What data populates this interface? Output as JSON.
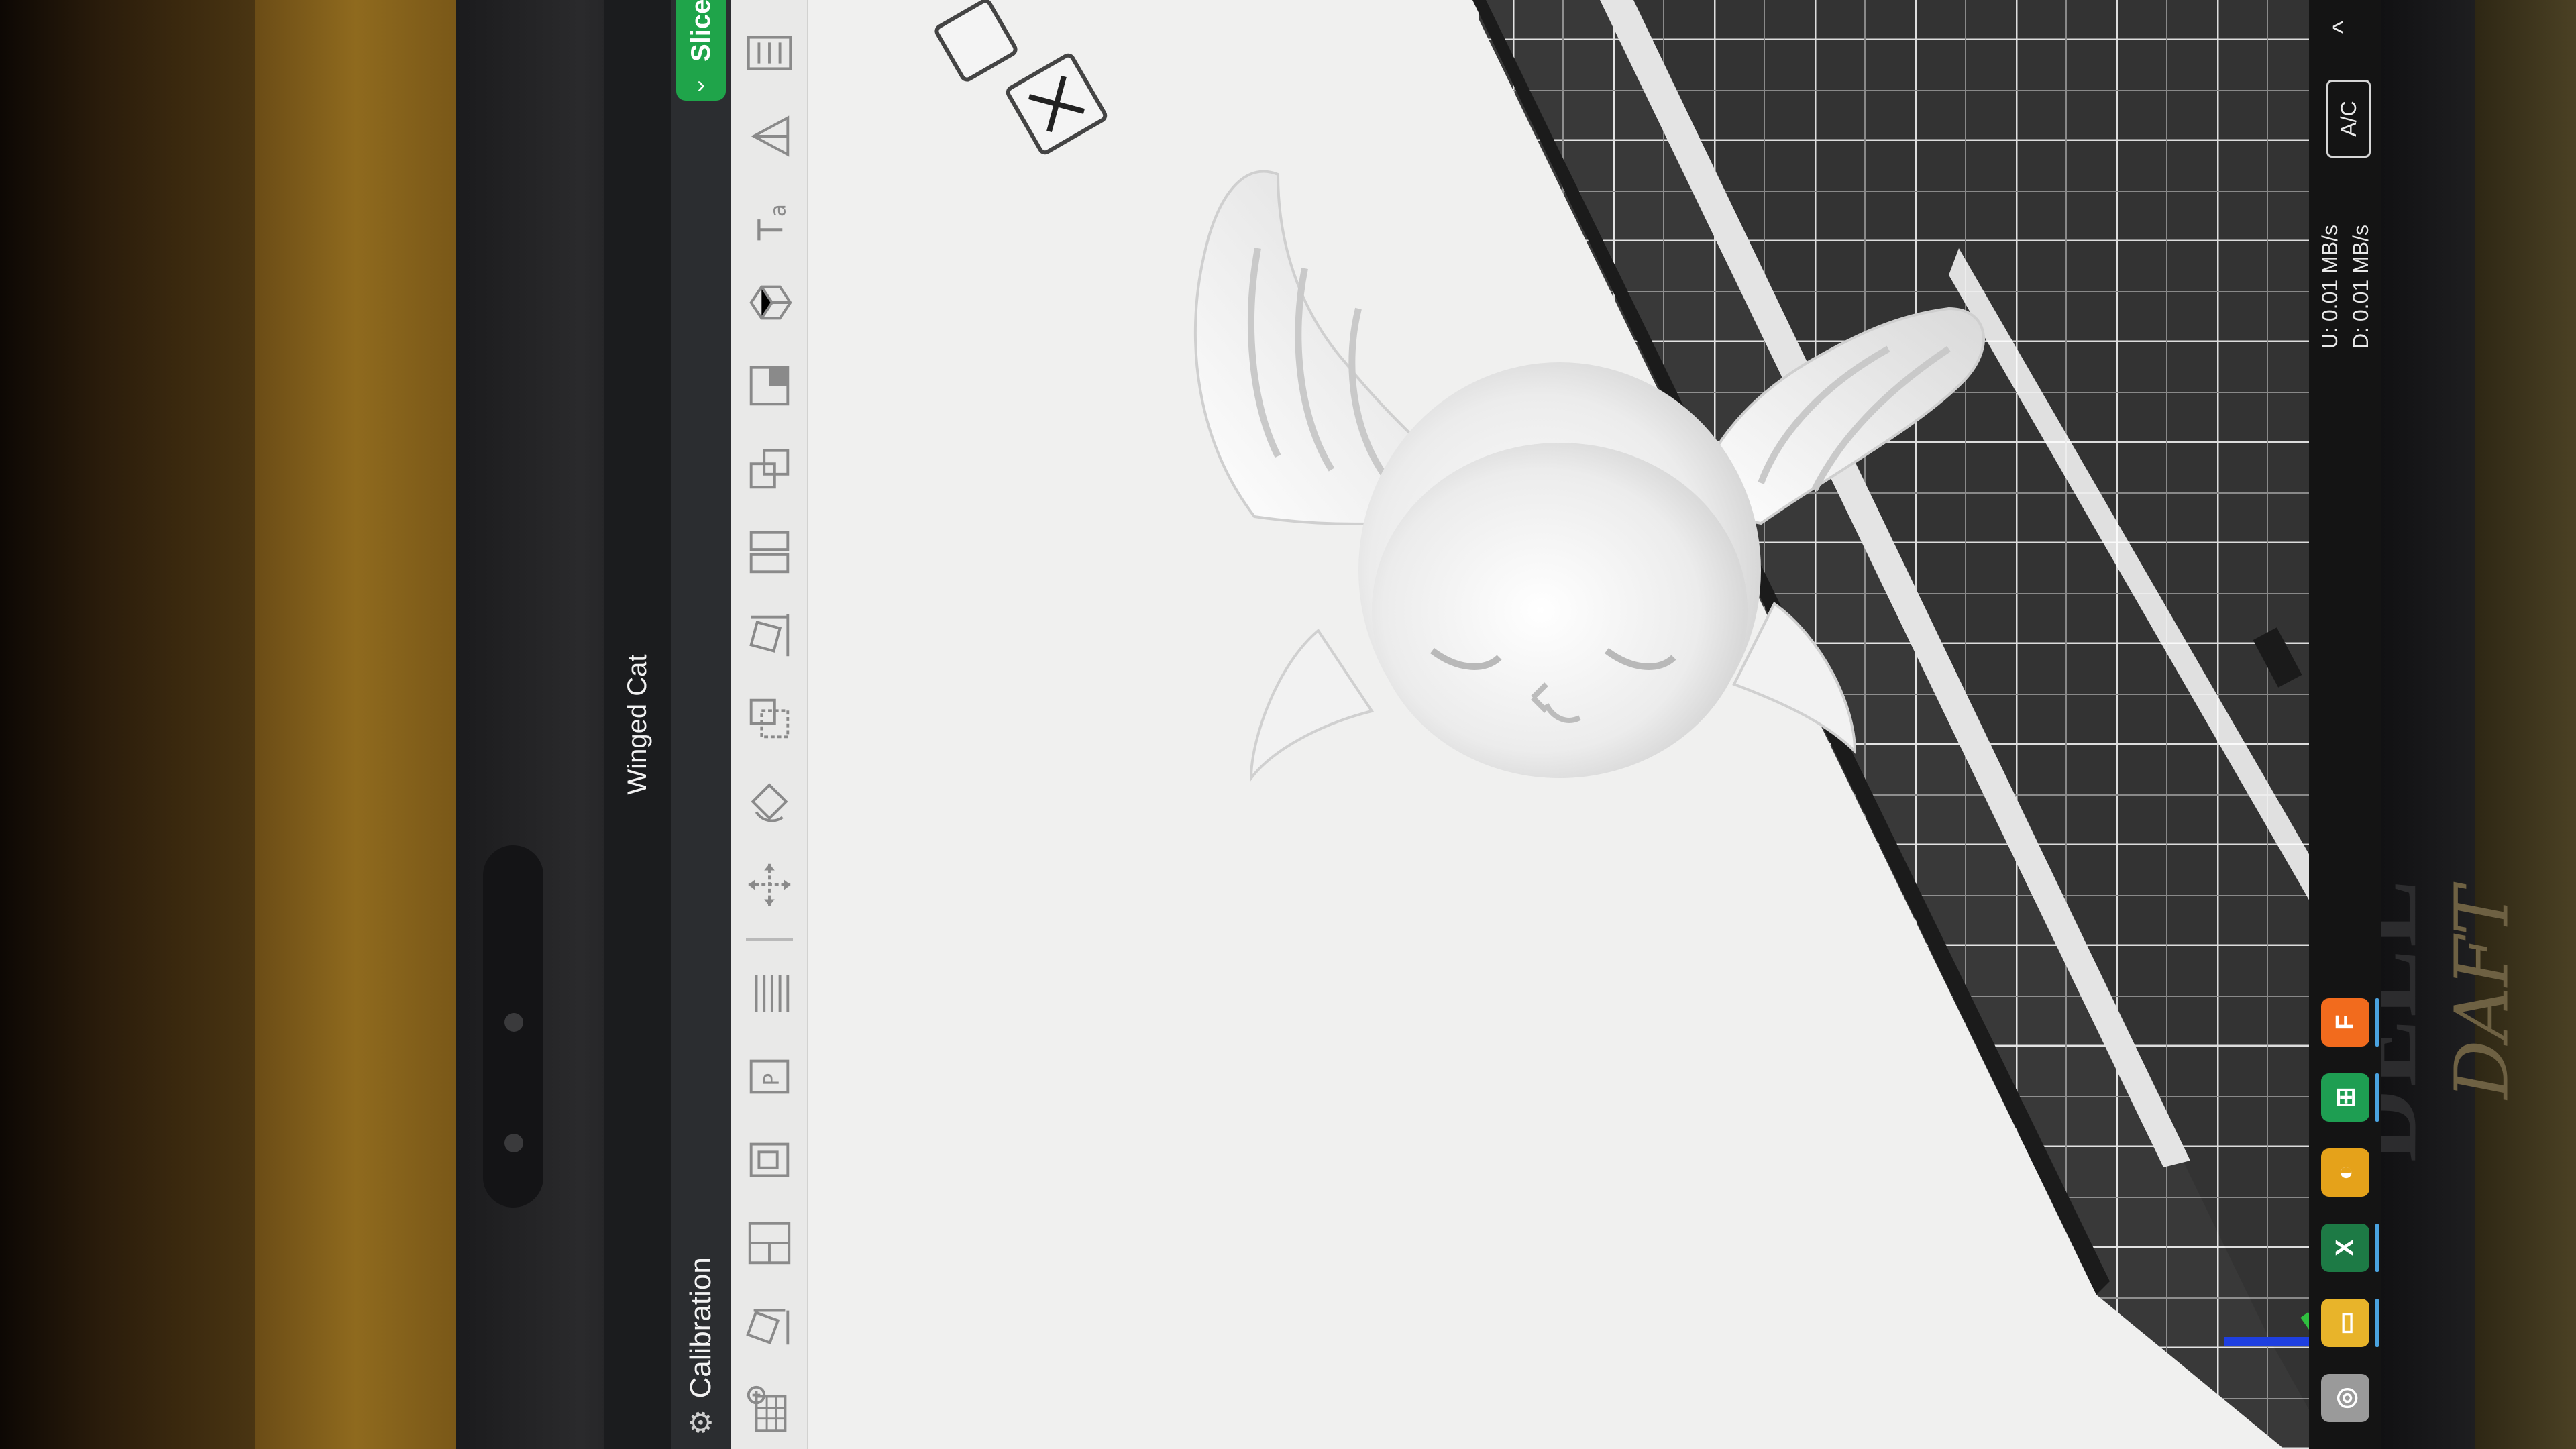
{
  "window": {
    "title": "Winged Cat"
  },
  "toolbar": {
    "calibration_label": "Calibration",
    "slice_label": "Slice"
  },
  "tools": [
    "add-plate",
    "auto-orient",
    "arrange",
    "plate-a",
    "plate-b",
    "layers",
    "move",
    "rotate",
    "scale",
    "place-on-face",
    "split",
    "cut",
    "support",
    "boolean",
    "text",
    "measure",
    "assembly"
  ],
  "taskbar": {
    "network_up": "U:  0.01 MB/s",
    "network_down": "D:  0.01 MB/s",
    "power_label": "A/C",
    "apps": [
      {
        "name": "chrome",
        "color": "#9a9a9a"
      },
      {
        "name": "file-explorer",
        "color": "#e8b42a"
      },
      {
        "name": "excel",
        "color": "#1d7a45",
        "glyph": "X"
      },
      {
        "name": "printer-app",
        "color": "#e5a21a"
      },
      {
        "name": "sheets",
        "color": "#1e9e52",
        "glyph": "⊞"
      },
      {
        "name": "orca-slicer",
        "color": "#f26b1d",
        "glyph": "F"
      }
    ]
  },
  "bed": {
    "plate_color": "#323232",
    "grid_color": "#e0e0e0"
  },
  "model": {
    "name": "Winged Cat",
    "color": "#f5f5f5"
  },
  "physical": {
    "laptop_brand": "DELL"
  }
}
